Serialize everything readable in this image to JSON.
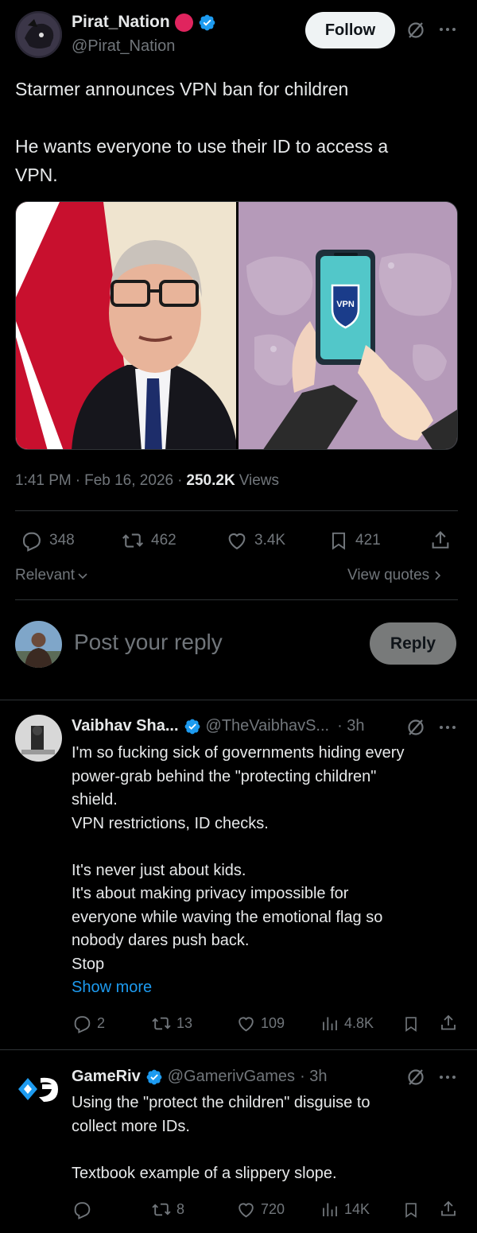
{
  "main_post": {
    "display_name": "Pirat_Nation",
    "handle": "@Pirat_Nation",
    "follow_label": "Follow",
    "text_line1": "Starmer announces VPN ban for children",
    "text_line2": "He wants everyone to use their ID to access a",
    "text_line3": "VPN.",
    "image_vpn_label": "VPN",
    "time": "1:41 PM",
    "date": "Feb 16, 2026",
    "views_count": "250.2K",
    "views_label": "Views",
    "stats": {
      "replies": "348",
      "reposts": "462",
      "likes": "3.4K",
      "bookmarks": "421"
    },
    "sort_label": "Relevant",
    "view_quotes_label": "View quotes"
  },
  "composer": {
    "placeholder": "Post your reply",
    "reply_label": "Reply"
  },
  "replies": [
    {
      "display_name": "Vaibhav Sha...",
      "handle": "@TheVaibhavS...",
      "age": "· 3h",
      "lines": [
        "I'm so fucking sick of governments hiding every",
        "power-grab behind the \"protecting children\"",
        "shield.",
        "VPN restrictions, ID checks.",
        "",
        "It's never just about kids.",
        "It's about making privacy impossible for",
        "everyone while waving the emotional flag so",
        "nobody dares push back.",
        "Stop"
      ],
      "show_more": "Show more",
      "stats": {
        "replies": "2",
        "reposts": "13",
        "likes": "109",
        "views": "4.8K"
      }
    },
    {
      "display_name": "GameRiv",
      "handle": "@GamerivGames",
      "age": "· 3h",
      "lines": [
        "Using the \"protect the children\" disguise to",
        "collect more IDs.",
        "",
        "Textbook example of a slippery slope."
      ],
      "stats": {
        "replies": "",
        "reposts": "8",
        "likes": "720",
        "views": "14K"
      }
    }
  ],
  "colors": {
    "background": "#000000",
    "text": "#e7e9ea",
    "muted": "#71767b",
    "link": "#1d9bf0",
    "verified": "#1d9bf0",
    "red_badge": "#e0245e",
    "divider": "#2f3336",
    "image_purple": "#b59ab9"
  },
  "icons": [
    "verified-badge-icon",
    "grok-icon",
    "more-icon",
    "reply-icon",
    "repost-icon",
    "like-icon",
    "bookmark-icon",
    "share-icon",
    "views-icon",
    "chevron-down-icon",
    "chevron-right-icon"
  ]
}
